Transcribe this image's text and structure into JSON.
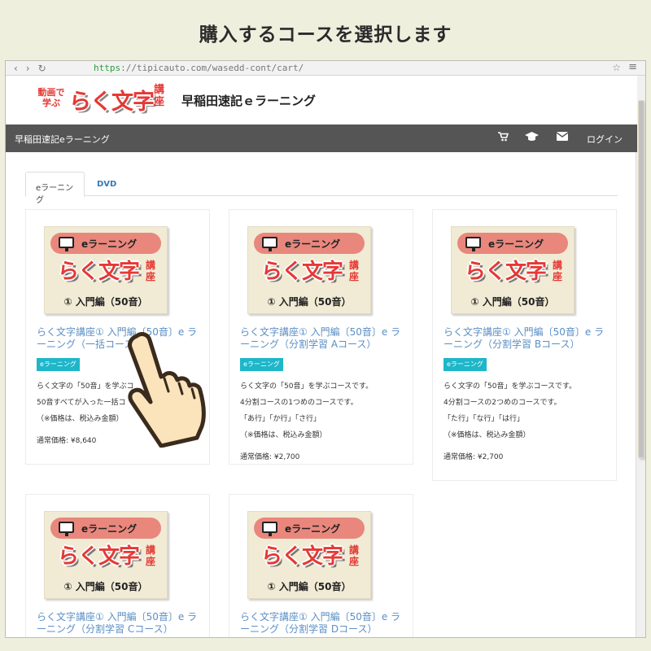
{
  "caption": "購入するコースを選択します",
  "browser": {
    "url_scheme": "https",
    "url_rest": "://tipicauto.com/wasedd-cont/cart/"
  },
  "header": {
    "logo_small": "動画で学ぶ",
    "logo_big": "らく文字",
    "logo_kouza": "講座",
    "site_name": "早稲田速記ｅラーニング"
  },
  "navbar": {
    "brand": "早稲田速記eラーニング",
    "cart_icon": "cart-icon",
    "grad_icon": "graduation-cap-icon",
    "mail_icon": "envelope-icon",
    "login": "ログイン"
  },
  "tabs": {
    "elearning": "eラーニング",
    "dvd": "DVD"
  },
  "thumbnail": {
    "pill": "eラーニング",
    "raku": "らく文字",
    "kouza": "講座",
    "sub": "① 入門編（50音）"
  },
  "products": [
    {
      "title": "らく文字講座① 入門編〔50音〕e ラーニング（一括コース）",
      "badge": "eラーニング",
      "desc": [
        "らく文字の「50音」を学ぶコ",
        "50音すべてが入った一括コ",
        "（※価格は、税込み金額）"
      ],
      "price": "通常価格: ¥8,640"
    },
    {
      "title": "らく文字講座① 入門編〔50音〕e ラーニング（分割学習 Aコース）",
      "badge": "eラーニング",
      "desc": [
        "らく文字の「50音」を学ぶコースです。",
        "4分割コースの1つめのコースです。",
        "「あ行」「か行」「さ行」",
        "（※価格は、税込み金額）"
      ],
      "price": "通常価格: ¥2,700"
    },
    {
      "title": "らく文字講座① 入門編〔50音〕e ラーニング（分割学習 Bコース）",
      "badge": "eラーニング",
      "desc": [
        "らく文字の「50音」を学ぶコースです。",
        "4分割コースの2つめのコースです。",
        "「た行」「な行」「は行」",
        "（※価格は、税込み金額）"
      ],
      "price": "通常価格: ¥2,700"
    },
    {
      "title": "らく文字講座① 入門編〔50音〕e ラーニング（分割学習 Cコース）"
    },
    {
      "title": "らく文字講座① 入門編〔50音〕e ラーニング（分割学習 Dコース）"
    }
  ]
}
